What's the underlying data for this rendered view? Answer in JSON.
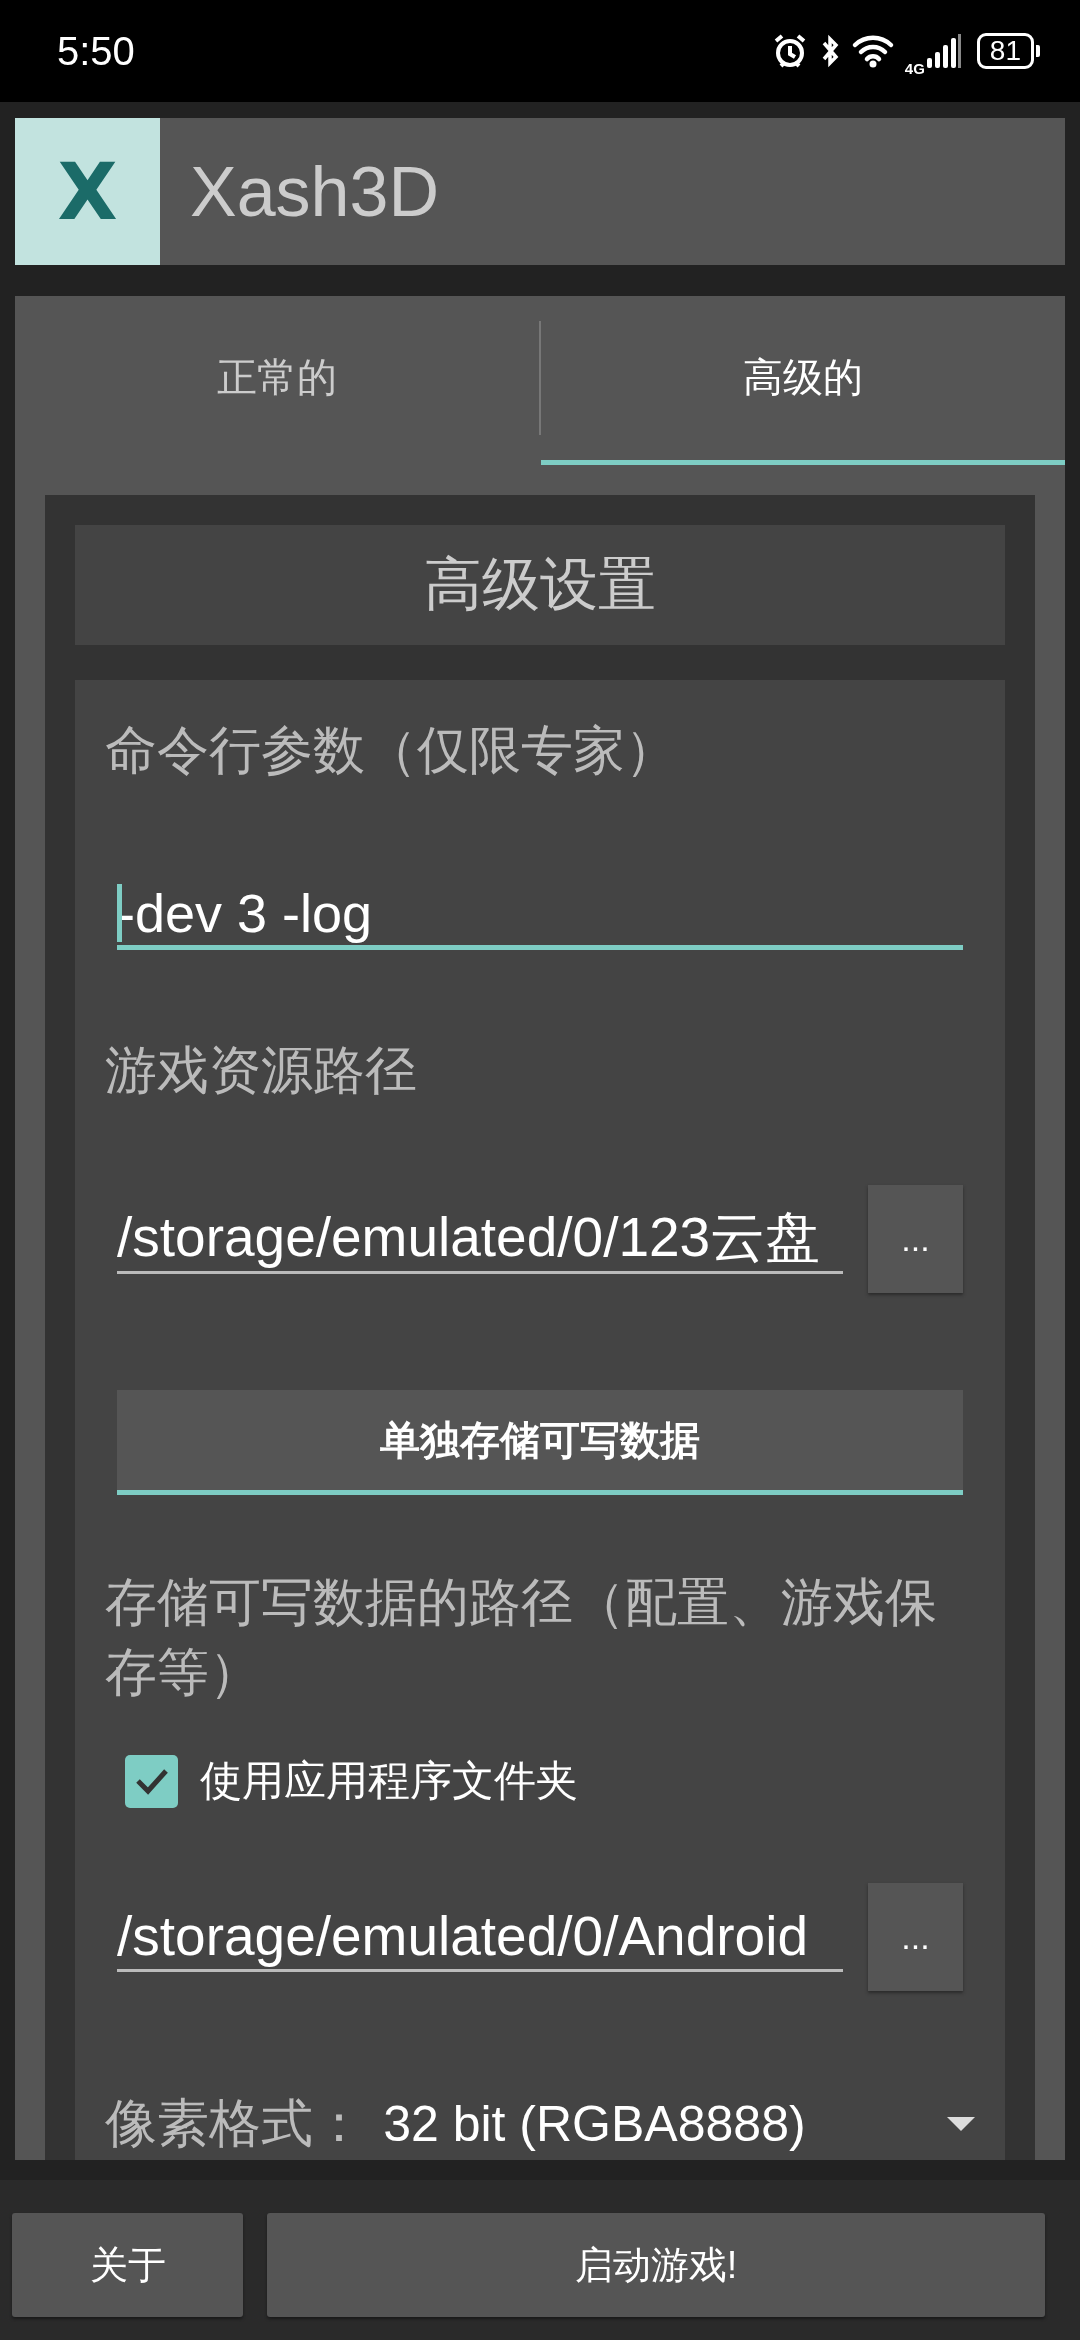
{
  "status_bar": {
    "time": "5:50",
    "network": "4G",
    "battery": "81"
  },
  "app_bar": {
    "logo": "X",
    "title": "Xash3D"
  },
  "tabs": [
    {
      "label": "正常的",
      "selected": false
    },
    {
      "label": "高级的",
      "selected": true
    }
  ],
  "section_title": "高级设置",
  "settings": [
    {
      "kind": "text_field",
      "label": "命令行参数（仅限专家）",
      "value": "-dev 3 -log",
      "focused": true
    },
    {
      "kind": "path_field",
      "label": "游戏资源路径",
      "value": "/storage/emulated/0/123云盘",
      "browse": "..."
    },
    {
      "kind": "button",
      "label": "单独存储可写数据"
    },
    {
      "kind": "path_field",
      "label": "存储可写数据的路径（配置、游戏保存等）",
      "checkbox": {
        "label": "使用应用程序文件夹",
        "checked": true
      },
      "value": "/storage/emulated/0/Android",
      "browse": "..."
    },
    {
      "kind": "dropdown",
      "label": "像素格式：",
      "value": "32 bit (RGBA8888)"
    }
  ],
  "bottom_buttons": [
    "关于",
    "启动游戏!"
  ]
}
